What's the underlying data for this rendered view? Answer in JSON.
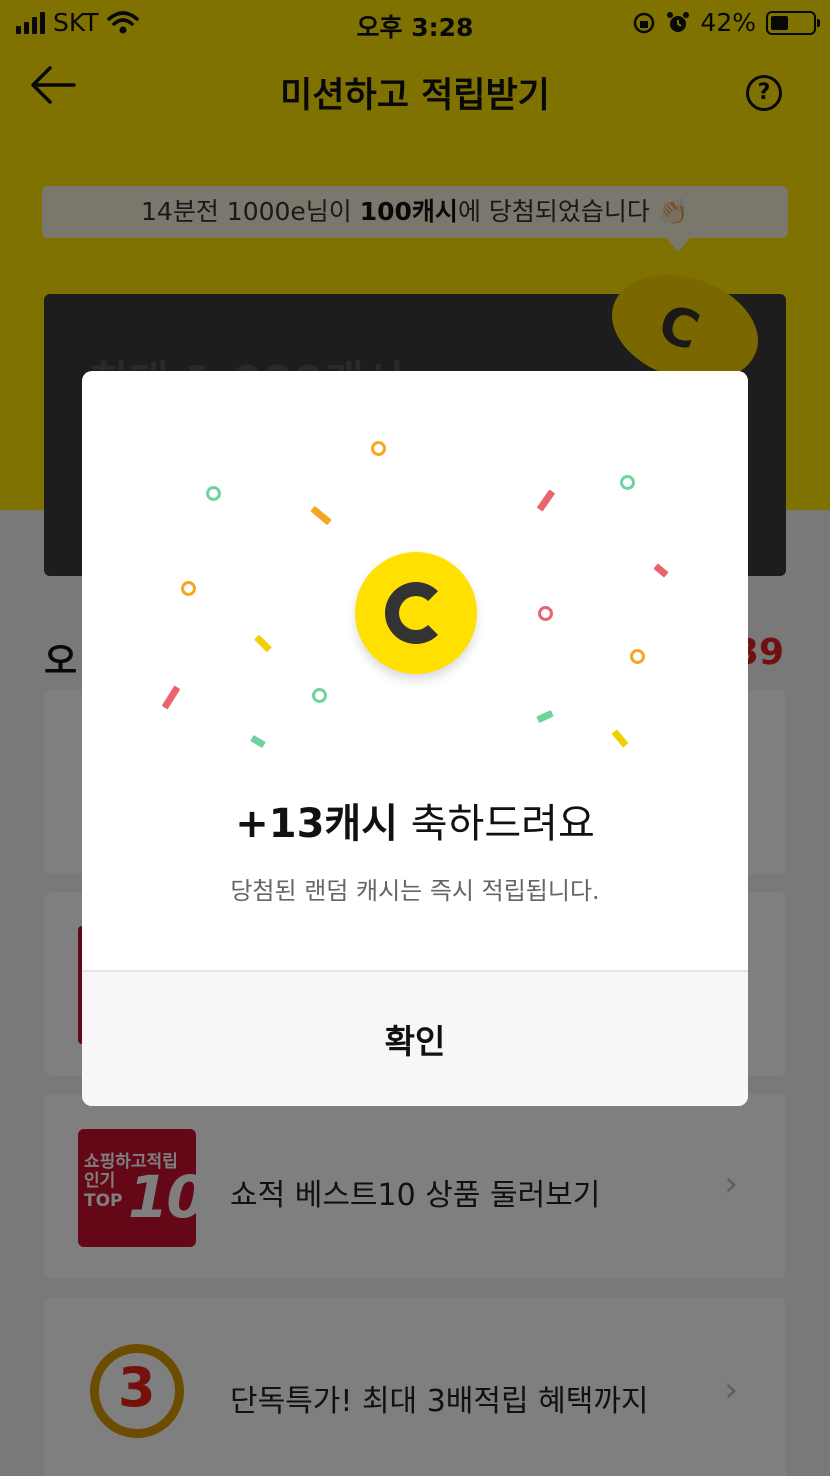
{
  "status_bar": {
    "carrier": "SKT",
    "time": "오후 3:28",
    "battery": "42%",
    "battery_level": 0.42
  },
  "header": {
    "title": "미션하고 적립받기",
    "back_icon": "arrow-left-icon",
    "help_icon": "question-circle-icon",
    "help_glyph": "?"
  },
  "ticker": {
    "prefix": "14분전 1000e님이 ",
    "highlight": "100캐시",
    "suffix": "에 당첨되었습니다 👏🏻"
  },
  "banner": {
    "text": "최대 1,000캐시"
  },
  "section": {
    "title_partial": "오",
    "count_partial": "39"
  },
  "missions": [
    {
      "label": "쇼적 베스트10 상품 둘러보기",
      "thumb_line1": "쇼핑하고적립",
      "thumb_line2": "인기\nTOP",
      "thumb_big": "10"
    },
    {
      "label": "단독특가! 최대 3배적립 혜택까지",
      "thumb_big": "3"
    }
  ],
  "chevron": "›",
  "modal": {
    "coin_icon": "cash-coin-icon",
    "headline_bold": "+13캐시",
    "headline_rest": " 축하드려요",
    "subtext": "당첨된 랜덤 캐시는 즉시 적립됩니다.",
    "confirm_label": "확인"
  },
  "colors": {
    "brand_yellow": "#fee500",
    "coin_yellow": "#ffe000",
    "alert_red": "#e02020",
    "confetti_orange": "#f5a623",
    "confetti_green": "#6fd3a0",
    "confetti_red": "#e8646e",
    "confetti_yellow": "#f0d000"
  }
}
